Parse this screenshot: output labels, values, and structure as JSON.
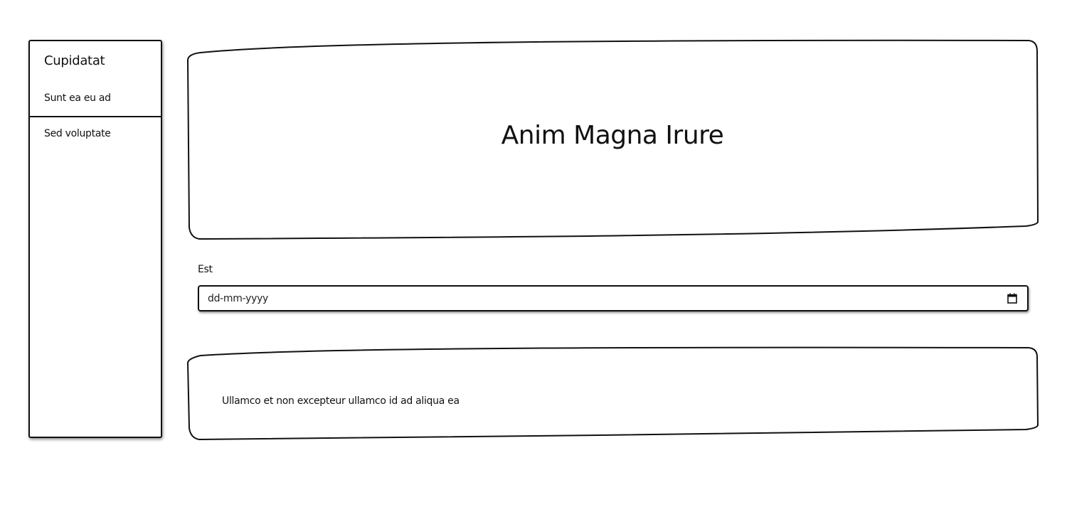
{
  "sidebar": {
    "title": "Cupidatat",
    "items": [
      {
        "label": "Sunt ea eu ad"
      },
      {
        "label": "Sed voluptate"
      }
    ]
  },
  "hero": {
    "title": "Anim Magna Irure"
  },
  "date_field": {
    "label": "Est",
    "placeholder": "dd-mm-yyyy",
    "icon": "calendar-icon"
  },
  "note": {
    "text": "Ullamco et non excepteur ullamco id ad aliqua ea"
  }
}
